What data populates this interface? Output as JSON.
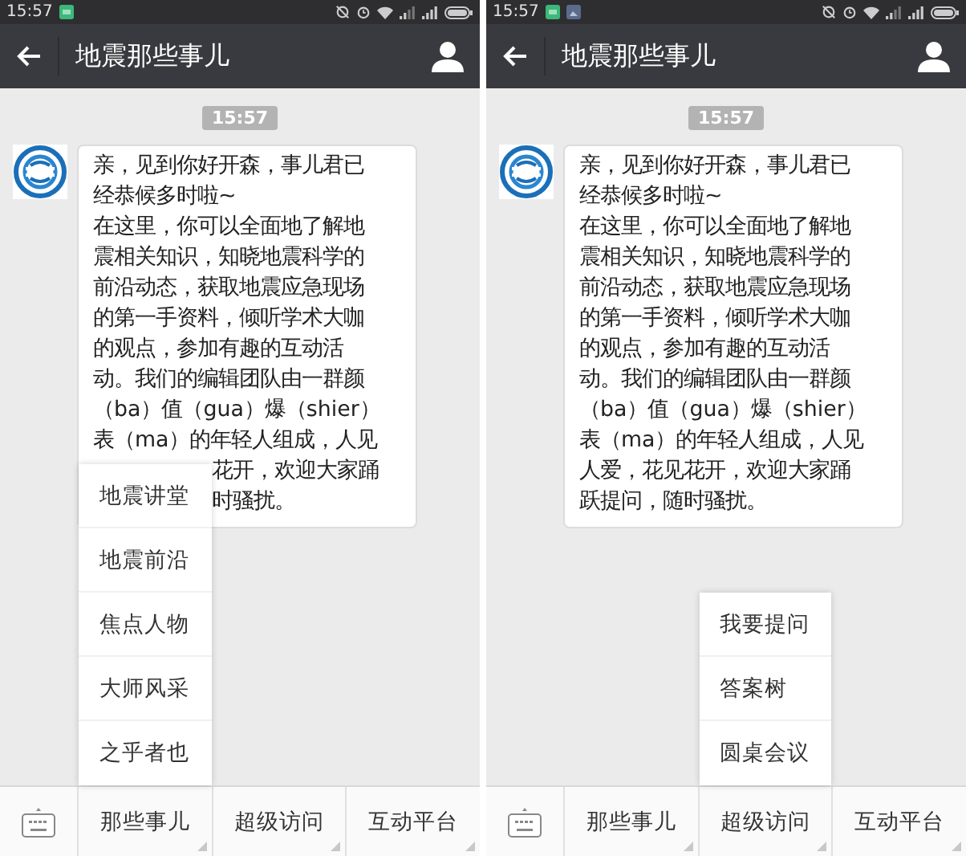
{
  "screens": [
    {
      "status_bar": {
        "time": "15:57",
        "notifications": [
          {
            "kind": "app"
          }
        ]
      },
      "header": {
        "title": "地震那些事儿"
      },
      "chat": {
        "timestamp": "15:57",
        "lines": [
          {
            "kind": "line",
            "text": "亲，见到你好开森，事儿君已"
          },
          {
            "kind": "line",
            "text": "经恭候多时啦~"
          },
          {
            "kind": "line",
            "text": "在这里，你可以全面地了解地"
          },
          {
            "kind": "line",
            "text": "震相关知识，知晓地震科学的"
          },
          {
            "kind": "line",
            "text": "前沿动态，获取地震应急现场"
          },
          {
            "kind": "line",
            "text": "的第一手资料，倾听学术大咖"
          },
          {
            "kind": "line",
            "text": "的观点，参加有趣的互动活"
          },
          {
            "kind": "line",
            "text": "动。我们的编辑团队由一群颜"
          },
          {
            "kind": "line",
            "text": "（ba）值（gua）爆（shier）"
          },
          {
            "kind": "line",
            "text": "表（ma）的年轻人组成，人见"
          },
          {
            "kind": "tail",
            "text": "花开，欢迎大家踊"
          },
          {
            "kind": "tail",
            "text": "时骚扰。"
          }
        ]
      },
      "menu_bar": {
        "buttons": [
          {
            "label": "那些事儿",
            "submenu": [
              "地震讲堂",
              "地震前沿",
              "焦点人物",
              "大师风采",
              "之乎者也"
            ]
          },
          {
            "label": "超级访问"
          },
          {
            "label": "互动平台"
          }
        ]
      }
    },
    {
      "status_bar": {
        "time": "15:57",
        "notifications": [
          {
            "kind": "app"
          },
          {
            "kind": "gallery"
          }
        ]
      },
      "header": {
        "title": "地震那些事儿"
      },
      "chat": {
        "timestamp": "15:57",
        "lines": [
          {
            "kind": "line",
            "text": "亲，见到你好开森，事儿君已"
          },
          {
            "kind": "line",
            "text": "经恭候多时啦~"
          },
          {
            "kind": "line",
            "text": "在这里，你可以全面地了解地"
          },
          {
            "kind": "line",
            "text": "震相关知识，知晓地震科学的"
          },
          {
            "kind": "line",
            "text": "前沿动态，获取地震应急现场"
          },
          {
            "kind": "line",
            "text": "的第一手资料，倾听学术大咖"
          },
          {
            "kind": "line",
            "text": "的观点，参加有趣的互动活"
          },
          {
            "kind": "line",
            "text": "动。我们的编辑团队由一群颜"
          },
          {
            "kind": "line",
            "text": "（ba）值（gua）爆（shier）"
          },
          {
            "kind": "line",
            "text": "表（ma）的年轻人组成，人见"
          },
          {
            "kind": "line",
            "text": "人爱，花见花开，欢迎大家踊"
          },
          {
            "kind": "line",
            "text": "跃提问，随时骚扰。"
          }
        ]
      },
      "menu_bar": {
        "buttons": [
          {
            "label": "那些事儿"
          },
          {
            "label": "超级访问",
            "submenu": [
              "我要提问",
              "答案树",
              "圆桌会议"
            ]
          },
          {
            "label": "互动平台"
          }
        ]
      }
    }
  ]
}
